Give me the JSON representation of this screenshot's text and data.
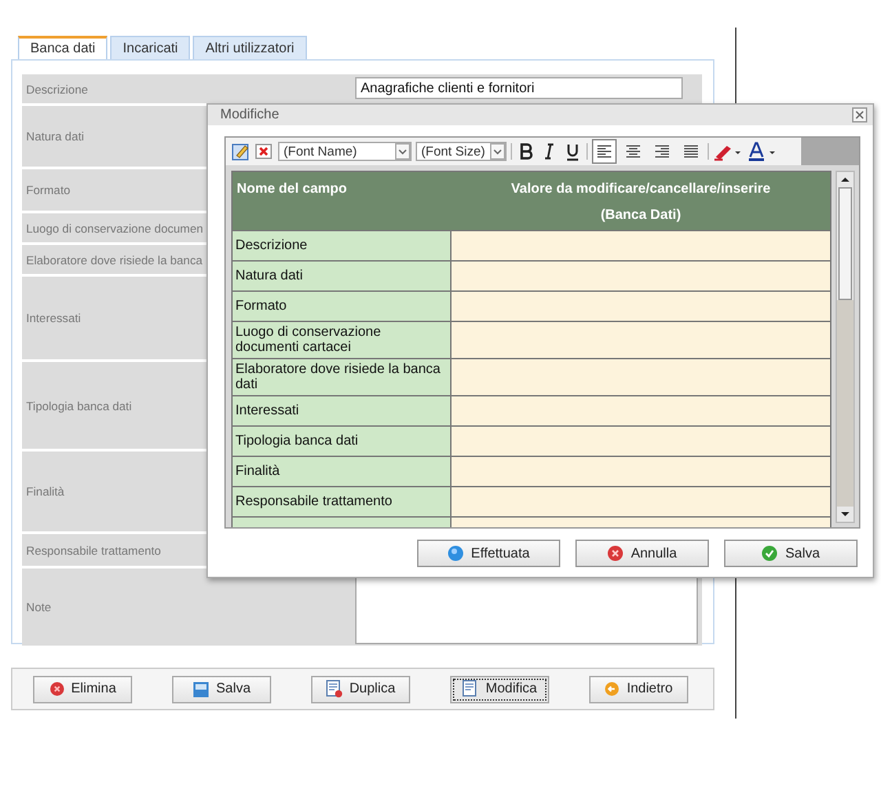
{
  "tabs": [
    {
      "label": "Banca dati",
      "selected": true
    },
    {
      "label": "Incaricati",
      "selected": false
    },
    {
      "label": "Altri utilizzatori",
      "selected": false
    }
  ],
  "form": {
    "rows": [
      {
        "label": "Descrizione",
        "value": "Anagrafiche clienti e fornitori",
        "kind": "input"
      },
      {
        "label": "Natura dati"
      },
      {
        "label": "Formato"
      },
      {
        "label": "Luogo di conservazione documen"
      },
      {
        "label": "Elaboratore dove risiede la banca"
      },
      {
        "label": "Interessati"
      },
      {
        "label": "Tipologia banca dati"
      },
      {
        "label": "Finalità"
      },
      {
        "label": "Responsabile trattamento"
      },
      {
        "label": "Note",
        "kind": "textarea"
      }
    ]
  },
  "actions": [
    {
      "label": "Elimina",
      "kind": "delete",
      "focused": false
    },
    {
      "label": "Salva",
      "kind": "save",
      "focused": false
    },
    {
      "label": "Duplica",
      "kind": "duplicate",
      "focused": false
    },
    {
      "label": "Modifica",
      "kind": "edit",
      "focused": true
    },
    {
      "label": "Indietro",
      "kind": "back",
      "focused": false
    }
  ],
  "dialog": {
    "title": "Modifiche",
    "toolbar": [
      {
        "kind": "edit"
      },
      {
        "kind": "delete"
      },
      {
        "kind": "select",
        "value": "(Font Name)"
      },
      {
        "kind": "select",
        "value": "(Font Size)"
      },
      {
        "kind": "sep"
      },
      {
        "kind": "bold"
      },
      {
        "kind": "italic"
      },
      {
        "kind": "underline"
      },
      {
        "kind": "sep"
      },
      {
        "kind": "align-left",
        "selected": true
      },
      {
        "kind": "align-center",
        "selected": false
      },
      {
        "kind": "align-right",
        "selected": false
      },
      {
        "kind": "justify",
        "selected": false
      },
      {
        "kind": "sep"
      },
      {
        "kind": "highlight"
      },
      {
        "kind": "font-color"
      }
    ],
    "table": {
      "header": [
        "Nome del campo",
        "Valore da modificare/cancellare/inserire",
        "(Banca Dati)"
      ],
      "rows": [
        "Descrizione",
        "Natura dati",
        "Formato",
        "Luogo di conservazione documenti cartacei",
        "Elaboratore dove risiede la banca dati",
        "Interessati",
        "Tipologia banca dati",
        "Finalità",
        "Responsabile trattamento"
      ]
    },
    "buttons": [
      {
        "label": "Effettuata",
        "kind": "done"
      },
      {
        "label": "Annulla",
        "kind": "cancel"
      },
      {
        "label": "Salva",
        "kind": "save"
      }
    ]
  }
}
